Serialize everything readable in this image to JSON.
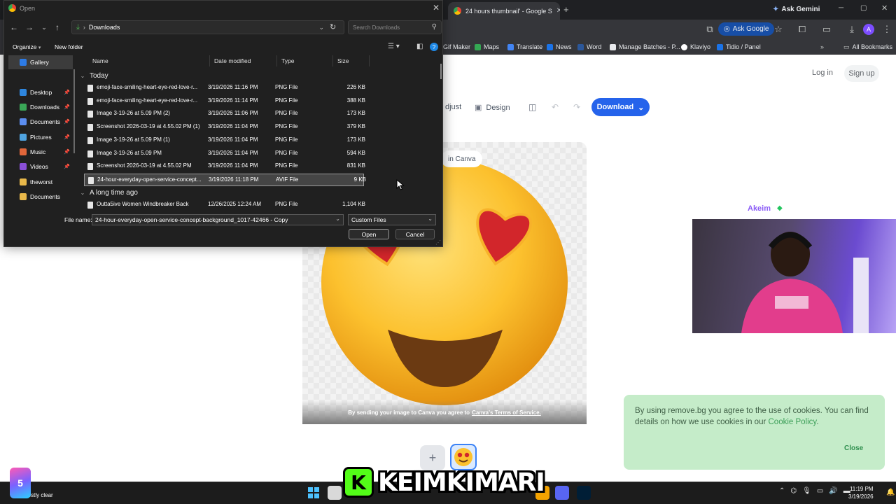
{
  "chrome": {
    "tabs": [
      {
        "label": "24 hours thumbnail' - Google S"
      }
    ],
    "ask_gemini": "Ask Gemini",
    "ask_google": "Ask Google",
    "avatar_letter": "A",
    "bookmarks": [
      {
        "label": "Gif Maker",
        "color": "#ffffff"
      },
      {
        "label": "Maps",
        "color": "#34a853"
      },
      {
        "label": "Translate",
        "color": "#4285f4"
      },
      {
        "label": "News",
        "color": "#1a73e8"
      },
      {
        "label": "Word",
        "color": "#2b579a"
      },
      {
        "label": "Manage Batches - P...",
        "color": "#e8eaed"
      },
      {
        "label": "Klaviyo",
        "color": "#ffffff"
      },
      {
        "label": "Tidio / Panel",
        "color": "#1a73e8"
      }
    ],
    "all_bookmarks": "All Bookmarks"
  },
  "page": {
    "login": "Log in",
    "signup": "Sign up",
    "adjust": "djust",
    "design": "Design",
    "download": "Download",
    "in_canva": "in Canva",
    "terms_prefix": "By sending your image to Canva you agree to",
    "terms_link": "Canva's Terms of Service.",
    "add_symbol": "+",
    "cookie_text_1": "By using remove.bg you agree to the use of cookies. You can find details on how we use cookies in our ",
    "cookie_link": "Cookie Policy",
    "cookie_text_2": ".",
    "cookie_close": "Close",
    "accent": "#2563eb"
  },
  "stream": {
    "name": "Akeim",
    "brand": "KEIMKIMARI",
    "brand_k": "K",
    "corner": "5"
  },
  "dialog": {
    "title": "Open",
    "address": "Downloads",
    "search_placeholder": "Search Downloads",
    "organize": "Organize",
    "new_folder": "New folder",
    "nav": [
      {
        "label": "Gallery",
        "color": "#2d7be5",
        "pinned": false,
        "selected": true
      },
      {
        "label": "Desktop",
        "color": "#2e86de",
        "pinned": true
      },
      {
        "label": "Downloads",
        "color": "#3aa757",
        "pinned": true
      },
      {
        "label": "Documents",
        "color": "#5b8def",
        "pinned": true
      },
      {
        "label": "Pictures",
        "color": "#4fa3e0",
        "pinned": true
      },
      {
        "label": "Music",
        "color": "#e0663a",
        "pinned": true
      },
      {
        "label": "Videos",
        "color": "#8a4fd8",
        "pinned": true
      },
      {
        "label": "theworst",
        "color": "#e8b84a",
        "pinned": false
      },
      {
        "label": "Documents",
        "color": "#e8b84a",
        "pinned": false
      }
    ],
    "columns": [
      "Name",
      "Date modified",
      "Type",
      "Size"
    ],
    "group_today": "Today",
    "group_old": "A long time ago",
    "files_today": [
      {
        "name": "emoji-face-smiling-heart-eye-red-love-r...",
        "date": "3/19/2026 11:16 PM",
        "type": "PNG File",
        "size": "226 KB"
      },
      {
        "name": "emoji-face-smiling-heart-eye-red-love-r...",
        "date": "3/19/2026 11:14 PM",
        "type": "PNG File",
        "size": "388 KB"
      },
      {
        "name": "Image 3-19-26 at 5.09 PM (2)",
        "date": "3/19/2026 11:06 PM",
        "type": "PNG File",
        "size": "173 KB"
      },
      {
        "name": "Screenshot 2026-03-19 at 4.55.02 PM (1)",
        "date": "3/19/2026 11:04 PM",
        "type": "PNG File",
        "size": "379 KB"
      },
      {
        "name": "Image 3-19-26 at 5.09 PM (1)",
        "date": "3/19/2026 11:04 PM",
        "type": "PNG File",
        "size": "173 KB"
      },
      {
        "name": "Image 3-19-26 at 5.09 PM",
        "date": "3/19/2026 11:04 PM",
        "type": "PNG File",
        "size": "594 KB"
      },
      {
        "name": "Screenshot 2026-03-19 at 4.55.02 PM",
        "date": "3/19/2026 11:04 PM",
        "type": "PNG File",
        "size": "831 KB"
      },
      {
        "name": "24-hour-everyday-open-service-concept...",
        "date": "3/19/2026 11:18 PM",
        "type": "AVIF File",
        "size": "9 KB",
        "selected": true
      }
    ],
    "files_old": [
      {
        "name": "Outta5ive Women Windbreaker Back",
        "date": "12/26/2025 12:24 AM",
        "type": "PNG File",
        "size": "1,104 KB"
      }
    ],
    "file_name_label": "File name:",
    "file_name_value": "24-hour-everyday-open-service-concept-background_1017-42466 - Copy",
    "file_type": "Custom Files",
    "open": "Open",
    "cancel": "Cancel"
  },
  "taskbar": {
    "weather_temp": "°F",
    "weather_desc": "Mostly clear",
    "time": "11:19 PM",
    "date": "3/19/2026",
    "apps": [
      {
        "name": "search",
        "color": "#d9d9d9"
      },
      {
        "name": "browser",
        "color": "#f4a300"
      },
      {
        "name": "discord",
        "color": "#5865f2"
      },
      {
        "name": "photoshop",
        "color": "#001e36"
      }
    ]
  }
}
